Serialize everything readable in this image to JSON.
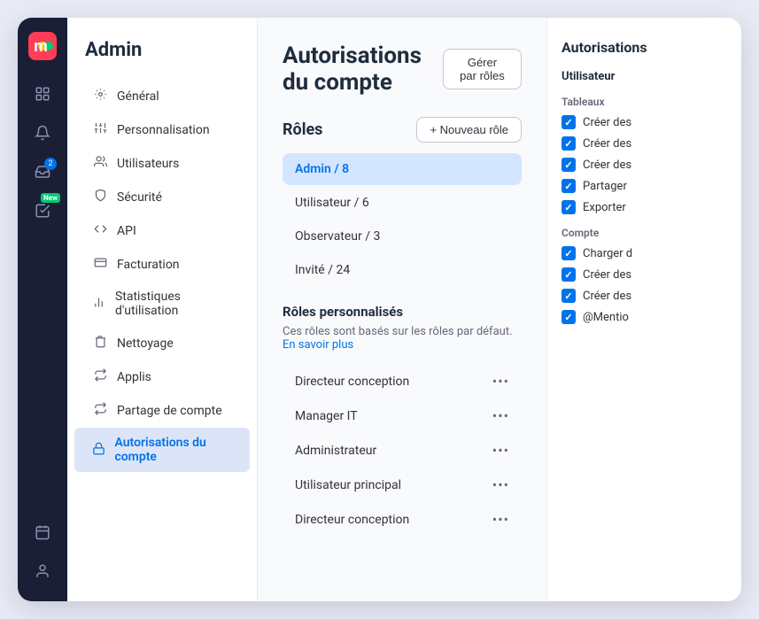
{
  "nav": {
    "logo_alt": "monday.com",
    "icons": [
      {
        "name": "home-icon",
        "symbol": "⊞",
        "badge": null
      },
      {
        "name": "bell-icon",
        "symbol": "🔔",
        "badge": null
      },
      {
        "name": "inbox-icon",
        "symbol": "✉",
        "badge": "2"
      },
      {
        "name": "tasks-icon",
        "symbol": "☑",
        "badge": "new"
      },
      {
        "name": "calendar-bottom-icon",
        "symbol": "📅",
        "badge": null
      },
      {
        "name": "user-bottom-icon",
        "symbol": "👤",
        "badge": null
      }
    ]
  },
  "sidebar": {
    "title": "Admin",
    "items": [
      {
        "id": "general",
        "label": "Général",
        "icon": "⚙"
      },
      {
        "id": "personalisation",
        "label": "Personnalisation",
        "icon": "🎨"
      },
      {
        "id": "utilisateurs",
        "label": "Utilisateurs",
        "icon": "👥"
      },
      {
        "id": "securite",
        "label": "Sécurité",
        "icon": "🛡"
      },
      {
        "id": "api",
        "label": "API",
        "icon": "⬡"
      },
      {
        "id": "facturation",
        "label": "Facturation",
        "icon": "🪟"
      },
      {
        "id": "statistiques",
        "label": "Statistiques d'utilisation",
        "icon": "📊"
      },
      {
        "id": "nettoyage",
        "label": "Nettoyage",
        "icon": "🗑"
      },
      {
        "id": "applis",
        "label": "Applis",
        "icon": "🔄"
      },
      {
        "id": "partage",
        "label": "Partage de compte",
        "icon": "⇄"
      },
      {
        "id": "autorisations",
        "label": "Autorisations du compte",
        "icon": "🔒"
      }
    ]
  },
  "main": {
    "title": "Autorisations du compte",
    "manage_roles_btn": "Gérer par rôles",
    "roles_section_title": "Rôles",
    "new_role_btn": "+ Nouveau rôle",
    "roles": [
      {
        "label": "Admin / 8",
        "active": true
      },
      {
        "label": "Utilisateur / 6",
        "active": false
      },
      {
        "label": "Observateur / 3",
        "active": false
      },
      {
        "label": "Invité / 24",
        "active": false
      }
    ],
    "custom_roles_title": "Rôles personnalisés",
    "custom_roles_desc": "Ces rôles sont basés sur les rôles par défaut.",
    "custom_roles_link": "En savoir plus",
    "custom_roles": [
      {
        "label": "Directeur conception"
      },
      {
        "label": "Manager IT"
      },
      {
        "label": "Administrateur"
      },
      {
        "label": "Utilisateur principal"
      },
      {
        "label": "Directeur conception"
      }
    ]
  },
  "right_panel": {
    "title": "Autorisations",
    "col_header": "Utilisateur",
    "sections": [
      {
        "title": "Tableaux",
        "permissions": [
          {
            "label": "Créer des",
            "checked": true
          },
          {
            "label": "Créer des",
            "checked": true
          },
          {
            "label": "Créer des",
            "checked": true
          },
          {
            "label": "Partager",
            "checked": true
          },
          {
            "label": "Exporter",
            "checked": true
          }
        ]
      },
      {
        "title": "Compte",
        "permissions": [
          {
            "label": "Charger d",
            "checked": true
          },
          {
            "label": "Créer des",
            "checked": true
          },
          {
            "label": "Créer des",
            "checked": true
          },
          {
            "label": "@Mentio",
            "checked": true
          }
        ]
      }
    ]
  }
}
